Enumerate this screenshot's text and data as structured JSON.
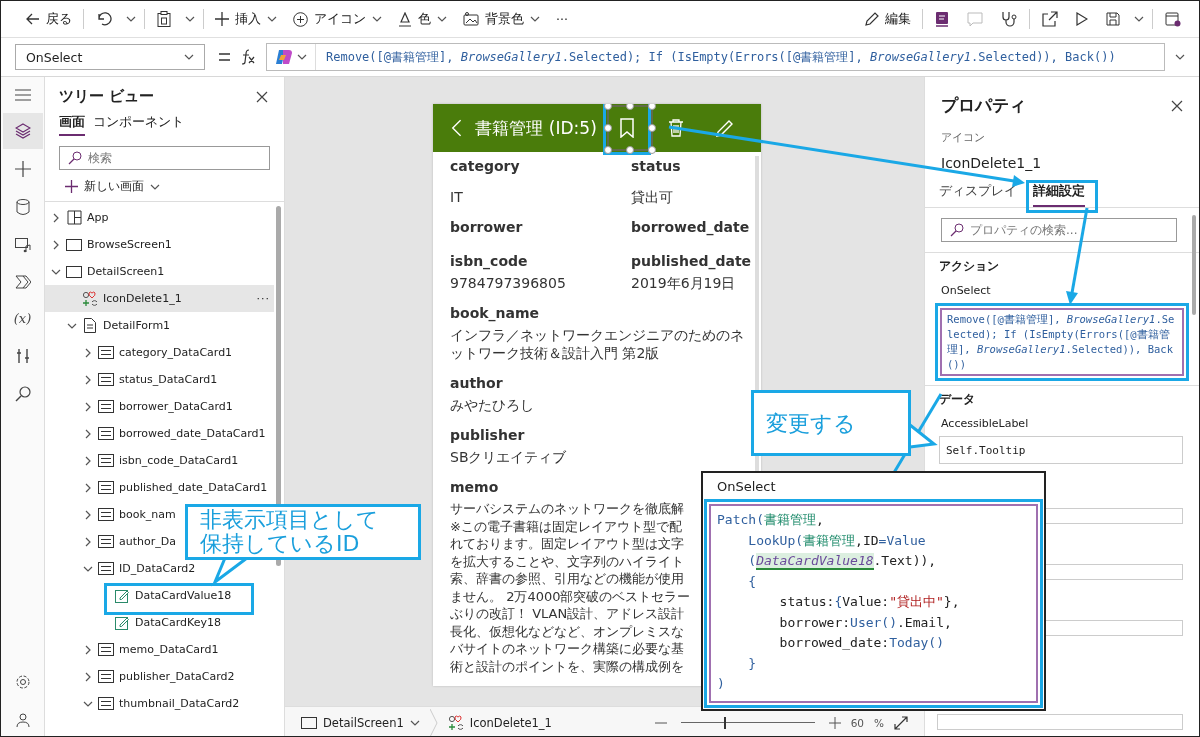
{
  "toolbar": {
    "back": "戻る",
    "insert": "挿入",
    "icon": "アイコン",
    "color_label": "色",
    "background": "背景色",
    "more": "···",
    "edit": "編集"
  },
  "formula_bar": {
    "property": "OnSelect",
    "formula": "Remove([@書籍管理], *BrowseGallery1*.Selected); If (IsEmpty(Errors([@書籍管理], *BrowseGallery1*.Selected)), Back())"
  },
  "rail": {
    "variables_glyph": "(x)"
  },
  "tree_view": {
    "title": "ツリー ビュー",
    "tabs": [
      {
        "label": "画面",
        "selected": true
      },
      {
        "label": "コンポーネント",
        "selected": false
      }
    ],
    "search": {
      "placeholder": "検索"
    },
    "new_screen": "新しい画面",
    "more_label": "···",
    "items": [
      {
        "label": "App",
        "kind": "app",
        "expanded": false,
        "selected": false
      },
      {
        "label": "BrowseScreen1",
        "kind": "screen",
        "expanded": false,
        "selected": false
      },
      {
        "label": "DetailScreen1",
        "kind": "screen",
        "expanded": true,
        "selected": false,
        "children": [
          {
            "label": "IconDelete1_1",
            "kind": "icon",
            "selected": true
          },
          {
            "label": "DetailForm1",
            "kind": "form",
            "expanded": true,
            "selected": false,
            "children": [
              {
                "label": "category_DataCard1",
                "kind": "card",
                "expanded": false,
                "selected": false
              },
              {
                "label": "status_DataCard1",
                "kind": "card",
                "expanded": false,
                "selected": false
              },
              {
                "label": "borrower_DataCard1",
                "kind": "card",
                "expanded": false,
                "selected": false
              },
              {
                "label": "borrowed_date_DataCard1",
                "kind": "card",
                "expanded": false,
                "selected": false
              },
              {
                "label": "isbn_code_DataCard1",
                "kind": "card",
                "expanded": false,
                "selected": false
              },
              {
                "label": "published_date_DataCard1",
                "kind": "card",
                "expanded": false,
                "selected": false
              },
              {
                "label": "book_nam",
                "kind": "card",
                "expanded": false,
                "selected": false
              },
              {
                "label": "author_Da",
                "kind": "card",
                "expanded": false,
                "selected": false
              },
              {
                "label": "ID_DataCard2",
                "kind": "card",
                "expanded": true,
                "selected": false,
                "children": [
                  {
                    "label": "DataCardValue18",
                    "kind": "input",
                    "selected": false
                  },
                  {
                    "label": "DataCardKey18",
                    "kind": "input",
                    "selected": false
                  }
                ]
              },
              {
                "label": "memo_DataCard1",
                "kind": "card",
                "expanded": false,
                "selected": false
              },
              {
                "label": "publisher_DataCard2",
                "kind": "card",
                "expanded": false,
                "selected": false
              },
              {
                "label": "thumbnail_DataCard2",
                "kind": "card",
                "expanded": true,
                "selected": false
              }
            ]
          }
        ]
      }
    ]
  },
  "screen_preview": {
    "title": "書籍管理 (ID:5)",
    "fields": [
      {
        "label": "category",
        "value": "IT",
        "kind": "half"
      },
      {
        "label": "status",
        "value": "貸出可",
        "kind": "half"
      },
      {
        "label": "borrower",
        "kind": "half"
      },
      {
        "label": "borrowed_date",
        "kind": "half"
      },
      {
        "label": "isbn_code",
        "value": "9784797396805",
        "kind": "half"
      },
      {
        "label": "published_date",
        "value": "2019年6月19日",
        "kind": "half"
      },
      {
        "label": "book_name",
        "value": "インフラ／ネットワークエンジニアのためのネットワーク技術＆設計入門 第2版",
        "kind": "full"
      },
      {
        "label": "author",
        "value": "みやたひろし",
        "kind": "full"
      },
      {
        "label": "publisher",
        "value": "SBクリエイティブ",
        "kind": "full"
      },
      {
        "label": "memo",
        "lines": [
          "サーバシステムのネットワークを徹底解",
          "※この電子書籍は固定レイアウト型で配",
          "れております。固定レイアウト型は文字",
          "を拡大することや、文字列のハイライト",
          "索、辞書の参照、引用などの機能が使用",
          "ません。 2万4000部突破のベストセラー",
          "ぶりの改訂！ VLAN設計、アドレス設計",
          "長化、仮想化などなど、オンプレミスな",
          "バサイトのネットワーク構築に必要な基",
          "術と設計のポイントを、実際の構成例を"
        ],
        "kind": "full"
      }
    ]
  },
  "properties": {
    "title": "プロパティ",
    "control_type": "アイコン",
    "control_name": "IconDelete1_1",
    "tabs": [
      {
        "label": "ディスプレイ",
        "selected": false
      },
      {
        "label": "詳細設定",
        "selected": true
      }
    ],
    "search": {
      "placeholder": "プロパティの検索..."
    },
    "sections": [
      {
        "title": "アクション",
        "props": [
          {
            "name": "OnSelect",
            "kind": "code",
            "formula": "Remove([@書籍管理], *BrowseGallery1*.Selected); If (IsEmpty(Errors([@書籍管理], *BrowseGallery1*.Selected)), Back())"
          }
        ]
      },
      {
        "title": "データ",
        "props": [
          {
            "name": "AccessibleLabel",
            "kind": "text",
            "value": "Self.Tooltip"
          }
        ]
      }
    ]
  },
  "status_bar": {
    "screen": "DetailScreen1",
    "control": "IconDelete1_1",
    "zoom": "60",
    "percent": "%",
    "zoom_slider": {
      "level": 0.32
    }
  },
  "annotations": {
    "callouts": [
      {
        "lines": [
          "非表示項目として",
          "保持しているID"
        ]
      },
      {
        "lines": [
          "変更する"
        ]
      }
    ],
    "popup": {
      "title": "OnSelect",
      "code_lines": [
        [
          {
            "text": "Patch(",
            "kind": "fn"
          },
          {
            "text": "書籍管理",
            "kind": "table"
          },
          {
            "text": ",",
            "kind": "plain"
          }
        ],
        [
          {
            "text": "    LookUp(",
            "kind": "fn"
          },
          {
            "text": "書籍管理",
            "kind": "table"
          },
          {
            "text": ",ID",
            "kind": "plain"
          },
          {
            "text": "=Value",
            "kind": "fn"
          }
        ],
        [
          {
            "text": "    (",
            "kind": "fn"
          },
          {
            "text": "DataCardValue18",
            "kind": "ref"
          },
          {
            "text": ".Text",
            "kind": "plain"
          },
          {
            "text": ")),",
            "kind": "plain"
          }
        ],
        [
          {
            "text": "    {",
            "kind": "fn"
          }
        ],
        [
          {
            "text": "        status:",
            "kind": "plain"
          },
          {
            "text": "{",
            "kind": "fn"
          },
          {
            "text": "Value:",
            "kind": "plain"
          },
          {
            "text": "\"貸出中\"",
            "kind": "string"
          },
          {
            "text": "},",
            "kind": "plain"
          }
        ],
        [
          {
            "text": "        borrower:",
            "kind": "plain"
          },
          {
            "text": "User()",
            "kind": "fn"
          },
          {
            "text": ".Email,",
            "kind": "plain"
          }
        ],
        [
          {
            "text": "        borrowed_date:",
            "kind": "plain"
          },
          {
            "text": "Today()",
            "kind": "fn"
          }
        ],
        [
          {
            "text": "    }",
            "kind": "fn"
          }
        ],
        [
          {
            "text": ")",
            "kind": "fn"
          }
        ]
      ]
    }
  }
}
